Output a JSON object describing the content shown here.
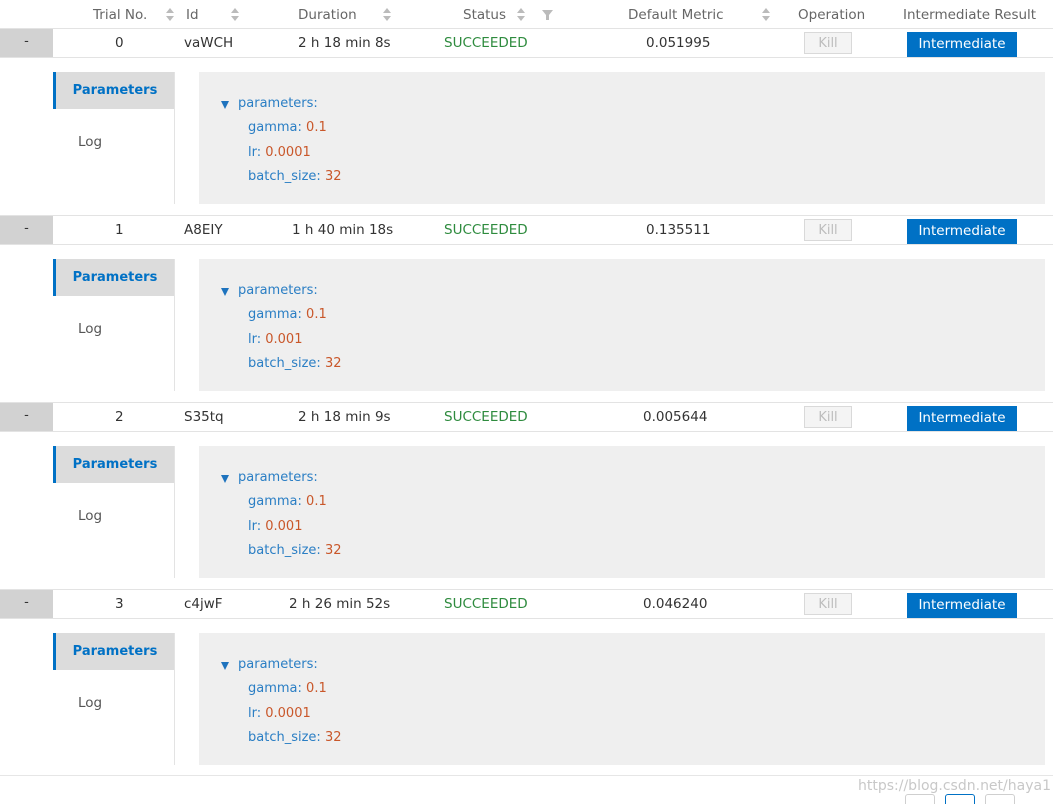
{
  "table": {
    "columns": {
      "trial_no": "Trial No.",
      "id": "Id",
      "duration": "Duration",
      "status": "Status",
      "default_metric": "Default Metric",
      "operation": "Operation",
      "intermediate_result": "Intermediate Result"
    },
    "expand_label": "-",
    "kill_label": "Kill",
    "intermediate_label": "Intermediate",
    "tabs": {
      "parameters": "Parameters",
      "log": "Log"
    },
    "params_root": "parameters:",
    "trials": [
      {
        "no": "0",
        "id": "vaWCH",
        "duration": "2 h 18 min 8s",
        "status": "SUCCEEDED",
        "metric": "0.051995",
        "params": {
          "gamma_key": "gamma:",
          "gamma": "0.1",
          "lr_key": "lr:",
          "lr": "0.0001",
          "batch_key": "batch_size:",
          "batch": "32"
        }
      },
      {
        "no": "1",
        "id": "A8EIY",
        "duration": "1 h 40 min 18s",
        "status": "SUCCEEDED",
        "metric": "0.135511",
        "params": {
          "gamma_key": "gamma:",
          "gamma": "0.1",
          "lr_key": "lr:",
          "lr": "0.001",
          "batch_key": "batch_size:",
          "batch": "32"
        }
      },
      {
        "no": "2",
        "id": "S35tq",
        "duration": "2 h 18 min 9s",
        "status": "SUCCEEDED",
        "metric": "0.005644",
        "params": {
          "gamma_key": "gamma:",
          "gamma": "0.1",
          "lr_key": "lr:",
          "lr": "0.001",
          "batch_key": "batch_size:",
          "batch": "32"
        }
      },
      {
        "no": "3",
        "id": "c4jwF",
        "duration": "2 h 26 min 52s",
        "status": "SUCCEEDED",
        "metric": "0.046240",
        "params": {
          "gamma_key": "gamma:",
          "gamma": "0.1",
          "lr_key": "lr:",
          "lr": "0.0001",
          "batch_key": "batch_size:",
          "batch": "32"
        }
      }
    ]
  },
  "watermark": "https://blog.csdn.net/haya1",
  "colors": {
    "accent": "#0071c5",
    "success": "#2e8b3e",
    "param_key": "#2a7ec4",
    "param_value": "#c9572a"
  },
  "icons": {
    "sort": "sort-arrows-icon",
    "filter": "filter-funnel-icon",
    "expand": "collapse-minus-icon",
    "triangle": "caret-down-icon"
  }
}
